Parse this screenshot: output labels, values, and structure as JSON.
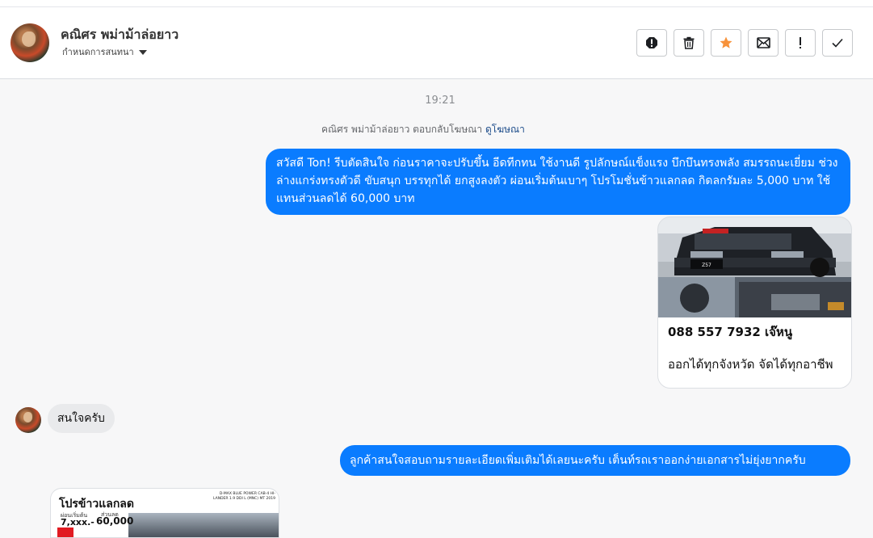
{
  "header": {
    "name": "คณิศร พม่าม้าล่อยาว",
    "subtitle": "กำหนดการสนทนา",
    "toolbar": [
      {
        "icon": "alert-circle-icon",
        "name": "spam-button"
      },
      {
        "icon": "trash-icon",
        "name": "delete-button"
      },
      {
        "icon": "star-icon",
        "name": "star-button",
        "color": "#f7923a"
      },
      {
        "icon": "envelope-icon",
        "name": "mark-unread-button"
      },
      {
        "icon": "exclamation-icon",
        "name": "flag-button"
      },
      {
        "icon": "check-icon",
        "name": "mark-done-button"
      }
    ]
  },
  "conversation": {
    "timestamp": "19:21",
    "reply_note": {
      "text": "คณิศร พม่าม้าล่อยาว ตอบกลับโฆษณา",
      "link": "ดูโฆษณา"
    },
    "messages": [
      {
        "direction": "outgoing",
        "text": "สวัสดี Ton! รีบตัดสินใจ ก่อนราคาจะปรับขึ้น อีดทีกทน ใช้งานดี รูปลักษณ์แข็งแรง บึกบึนทรงพลัง สมรรถนะเยี่ยม ช่วงล่างแกร่งทรงตัวดี ขับสนุก บรรทุกได้ ยกสูงลงตัว ผ่อนเริ่มต้นเบาๆ โปรโมชั่นข้าวแลกลด กิดลกรัมละ 5,000 บาท ใช้แทนส่วนลดได้ 60,000 บาท"
      },
      {
        "direction": "outgoing",
        "type": "card",
        "phone": "088 557 7932 เจ๊หนู",
        "caption": "ออกได้ทุกจังหวัด จัดได้ทุกอาชีพ",
        "plate": "Z57"
      },
      {
        "direction": "incoming",
        "text": "สนใจครับ"
      },
      {
        "direction": "outgoing",
        "text": "ลูกค้าสนใจสอบถามรายละเอียดเพิ่มเติมได้เลยนะครับ เต็นท์รถเราออกง่ายเอกสารไม่ยุ่งยากครับ"
      },
      {
        "direction": "incoming",
        "type": "image",
        "promo_title": "โปรข้าวแลกลด",
        "installment_label": "ผ่อนเริ่มต้น",
        "installment": "7,xxx.-",
        "discount_label": "ส่วนลด",
        "discount": "60,000",
        "model": "D-MAX BLUE POWER CAB-4 HI-LANDER 1.9 DDI L (MNC) MT 2019"
      }
    ]
  },
  "colors": {
    "outgoing_bubble": "#0a7cff",
    "incoming_bubble": "#e9eaec",
    "accent_star": "#f7923a"
  }
}
